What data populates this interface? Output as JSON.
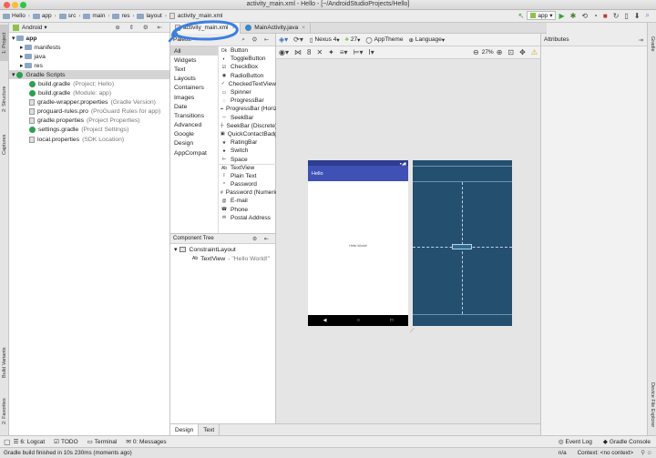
{
  "window": {
    "title": "activity_main.xml - Hello - [~/AndroidStudioProjects/Hello]"
  },
  "breadcrumbs": [
    "Hello",
    "app",
    "src",
    "main",
    "res",
    "layout",
    "activity_main.xml"
  ],
  "run_config": "app",
  "left_tool_tabs": [
    "1: Project",
    "2: Structure",
    "Captures",
    "Build Variants",
    "2: Favorites"
  ],
  "right_tool_tabs": [
    "Gradle",
    "Device File Explorer"
  ],
  "project": {
    "view_mode": "Android",
    "items": [
      {
        "label": "app",
        "hint": ""
      },
      {
        "label": "manifests",
        "hint": ""
      },
      {
        "label": "java",
        "hint": ""
      },
      {
        "label": "res",
        "hint": ""
      },
      {
        "label": "Gradle Scripts",
        "hint": ""
      },
      {
        "label": "build.gradle",
        "hint": "(Project: Hello)"
      },
      {
        "label": "build.gradle",
        "hint": "(Module: app)"
      },
      {
        "label": "gradle-wrapper.properties",
        "hint": "(Gradle Version)"
      },
      {
        "label": "proguard-rules.pro",
        "hint": "(ProGuard Rules for app)"
      },
      {
        "label": "gradle.properties",
        "hint": "(Project Properties)"
      },
      {
        "label": "settings.gradle",
        "hint": "(Project Settings)"
      },
      {
        "label": "local.properties",
        "hint": "(SDK Location)"
      }
    ]
  },
  "editor_tabs": [
    {
      "label": "activity_main.xml",
      "active": true
    },
    {
      "label": "MainActivity.java",
      "active": false
    }
  ],
  "palette": {
    "title": "Palette",
    "categories": [
      "All",
      "Widgets",
      "Text",
      "Layouts",
      "Containers",
      "Images",
      "Date",
      "Transitions",
      "Advanced",
      "Google",
      "Design",
      "AppCompat"
    ],
    "widgets": [
      {
        "icon": "Ok",
        "label": "Button"
      },
      {
        "icon": "◐",
        "label": "ToggleButton"
      },
      {
        "icon": "☑",
        "label": "CheckBox"
      },
      {
        "icon": "◉",
        "label": "RadioButton"
      },
      {
        "icon": "✓",
        "label": "CheckedTextView"
      },
      {
        "icon": "▭",
        "label": "Spinner"
      },
      {
        "icon": "◌",
        "label": "ProgressBar"
      },
      {
        "icon": "━",
        "label": "ProgressBar (Horizontal)"
      },
      {
        "icon": "─",
        "label": "SeekBar"
      },
      {
        "icon": "┼",
        "label": "SeekBar (Discrete)"
      },
      {
        "icon": "▣",
        "label": "QuickContactBadge"
      },
      {
        "icon": "★",
        "label": "RatingBar"
      },
      {
        "icon": "●",
        "label": "Switch"
      },
      {
        "icon": "⊢",
        "label": "Space"
      },
      {
        "icon": "Ab",
        "label": "TextView"
      },
      {
        "icon": "I",
        "label": "Plain Text"
      },
      {
        "icon": "*",
        "label": "Password"
      },
      {
        "icon": "#",
        "label": "Password (Numeric)"
      },
      {
        "icon": "@",
        "label": "E-mail"
      },
      {
        "icon": "☎",
        "label": "Phone"
      },
      {
        "icon": "✉",
        "label": "Postal Address"
      }
    ]
  },
  "component_tree": {
    "title": "Component Tree",
    "root": "ConstraintLayout",
    "child_type": "TextView",
    "child_text": "- \"Hello World!\""
  },
  "design_toolbar": {
    "device": "Nexus 4",
    "api": "27",
    "theme": "AppTheme",
    "language": "Language",
    "zoom": "27%"
  },
  "attributes": {
    "title": "Attributes"
  },
  "preview": {
    "app_title": "Hello",
    "center_text": "Hello World!"
  },
  "bottom_tabs": [
    {
      "label": "Design",
      "active": true
    },
    {
      "label": "Text",
      "active": false
    }
  ],
  "tool_windows": {
    "left": [
      "6: Logcat",
      "TODO",
      "Terminal",
      "0: Messages"
    ],
    "right": [
      "Event Log",
      "Gradle Console"
    ]
  },
  "status": {
    "message": "Gradle build finished in 10s 230ms (moments ago)",
    "na": "n/a",
    "context": "Context: <no context>"
  }
}
